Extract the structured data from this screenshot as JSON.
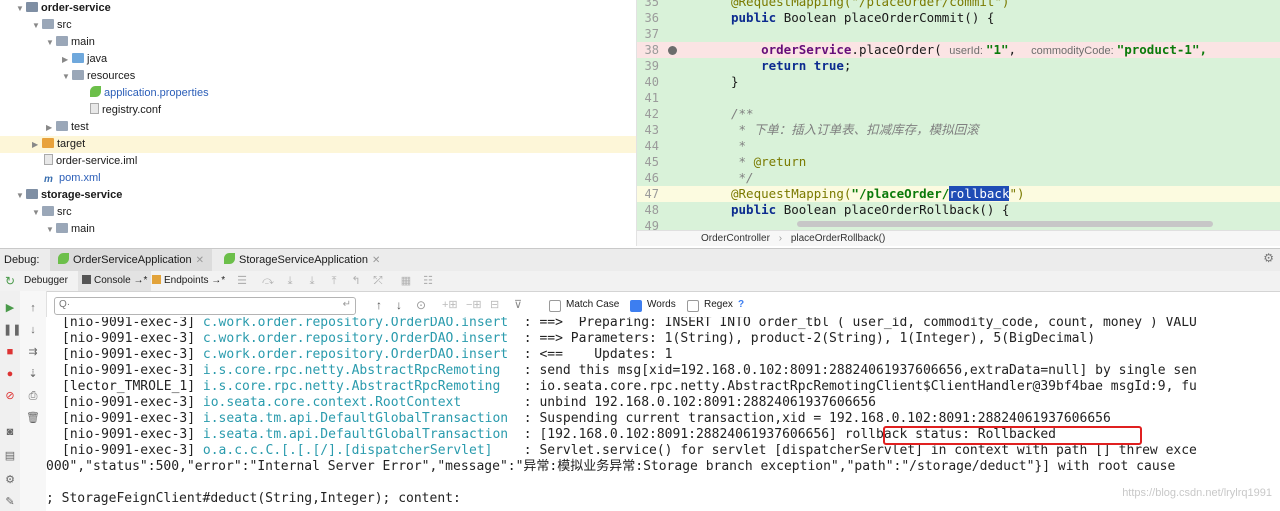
{
  "project_tree": {
    "items": [
      {
        "label": "order-service",
        "bold": true
      },
      {
        "label": "src"
      },
      {
        "label": "main"
      },
      {
        "label": "java"
      },
      {
        "label": "resources"
      },
      {
        "label": "application.properties"
      },
      {
        "label": "registry.conf"
      },
      {
        "label": "test"
      },
      {
        "label": "target"
      },
      {
        "label": "order-service.iml"
      },
      {
        "label": "pom.xml"
      },
      {
        "label": "storage-service",
        "bold": true
      },
      {
        "label": "src"
      },
      {
        "label": "main"
      }
    ]
  },
  "editor": {
    "lines": [
      {
        "n": "35",
        "segments": [
          {
            "t": "@RequestMapping(\"/placeOrder/commit\")",
            "c": "ann"
          }
        ]
      },
      {
        "n": "36",
        "segments": [
          {
            "t": "public ",
            "c": "kw"
          },
          {
            "t": "Boolean placeOrderCommit() {",
            "c": ""
          }
        ]
      },
      {
        "n": "37",
        "segments": []
      },
      {
        "n": "38",
        "segments": [
          {
            "t": "    ",
            "c": ""
          },
          {
            "t": "orderService",
            "c": "fld"
          },
          {
            "t": ".placeOrder( ",
            "c": ""
          },
          {
            "t": "userId: ",
            "c": "hint"
          },
          {
            "t": "\"1\"",
            "c": "str"
          },
          {
            "t": ",  ",
            "c": ""
          },
          {
            "t": "commodityCode: ",
            "c": "hint"
          },
          {
            "t": "\"product-1\",",
            "c": "str"
          }
        ]
      },
      {
        "n": "39",
        "segments": [
          {
            "t": "    ",
            "c": ""
          },
          {
            "t": "return true",
            "c": "kw"
          },
          {
            "t": ";",
            "c": ""
          }
        ]
      },
      {
        "n": "40",
        "segments": [
          {
            "t": "}",
            "c": ""
          }
        ]
      },
      {
        "n": "41",
        "segments": []
      },
      {
        "n": "42",
        "segments": [
          {
            "t": "/**",
            "c": "cmt"
          }
        ]
      },
      {
        "n": "43",
        "segments": [
          {
            "t": " * 下单：插入订单表、扣减库存，模拟回滚",
            "c": "cmt"
          }
        ]
      },
      {
        "n": "44",
        "segments": [
          {
            "t": " *",
            "c": "cmt"
          }
        ]
      },
      {
        "n": "45",
        "segments": [
          {
            "t": " * ",
            "c": "cmt"
          },
          {
            "t": "@return",
            "c": "ann"
          }
        ]
      },
      {
        "n": "46",
        "segments": [
          {
            "t": " */",
            "c": "cmt"
          }
        ]
      },
      {
        "n": "47",
        "segments": [
          {
            "t": "@RequestMapping(",
            "c": "ann"
          },
          {
            "t": "\"/placeOrder/",
            "c": "str"
          },
          {
            "t": "rollback",
            "c": "selbox"
          },
          {
            "t": "\")",
            "c": "ann"
          }
        ]
      },
      {
        "n": "48",
        "segments": [
          {
            "t": "public ",
            "c": "kw"
          },
          {
            "t": "Boolean placeOrderRollback() {",
            "c": ""
          }
        ]
      },
      {
        "n": "49",
        "segments": []
      }
    ],
    "breadcrumb": [
      "OrderController",
      "placeOrderRollback()"
    ],
    "breadcrumb_sep": "›"
  },
  "debug": {
    "label": "Debug:",
    "tabs": [
      "OrderServiceApplication",
      "StorageServiceApplication"
    ],
    "subtabs": {
      "debugger": "Debugger",
      "console": "Console",
      "endpoints": "Endpoints"
    },
    "search_placeholder": "Q·",
    "match_case": "Match Case",
    "words": "Words",
    "regex": "Regex",
    "regex_help": "?",
    "words_checked": true
  },
  "console": {
    "lines": [
      {
        "thread": "[nio-9091-exec-3]",
        "logger": "c.work.order.repository.OrderDAO.insert ",
        "msg": " : ==>  Preparing: INSERT INTO order_tbl ( user_id, commodity_code, count, money ) VALU"
      },
      {
        "thread": "[nio-9091-exec-3]",
        "logger": "c.work.order.repository.OrderDAO.insert ",
        "msg": " : ==> Parameters: 1(String), product-2(String), 1(Integer), 5(BigDecimal)"
      },
      {
        "thread": "[nio-9091-exec-3]",
        "logger": "c.work.order.repository.OrderDAO.insert ",
        "msg": " : <==    Updates: 1"
      },
      {
        "thread": "[nio-9091-exec-3]",
        "logger": "i.s.core.rpc.netty.AbstractRpcRemoting  ",
        "msg": " : send this msg[xid=192.168.0.102:8091:28824061937606656,extraData=null] by single sen"
      },
      {
        "thread": "[lector_TMROLE_1]",
        "logger": "i.s.core.rpc.netty.AbstractRpcRemoting  ",
        "msg": " : io.seata.core.rpc.netty.AbstractRpcRemotingClient$ClientHandler@39bf4bae msgId:9, fu"
      },
      {
        "thread": "[nio-9091-exec-3]",
        "logger": "io.seata.core.context.RootContext       ",
        "msg": " : unbind 192.168.0.102:8091:28824061937606656"
      },
      {
        "thread": "[nio-9091-exec-3]",
        "logger": "i.seata.tm.api.DefaultGlobalTransaction ",
        "msg": " : Suspending current transaction,xid = 192.168.0.102:8091:28824061937606656"
      },
      {
        "thread": "[nio-9091-exec-3]",
        "logger": "i.seata.tm.api.DefaultGlobalTransaction ",
        "msg": " : [192.168.0.102:8091:28824061937606656] rollback status: Rollbacked"
      },
      {
        "thread": "[nio-9091-exec-3]",
        "logger": "o.a.c.c.C.[.[.[/].[dispatcherServlet]   ",
        "msg": " : Servlet.service() for servlet [dispatcherServlet] in context with path [] threw exce"
      },
      {
        "thread": "",
        "logger": "",
        "msg": "000\",\"status\":500,\"error\":\"Internal Server Error\",\"message\":\"异常:模拟业务异常:Storage branch exception\",\"path\":\"/storage/deduct\"}] with root cause"
      },
      {
        "thread": "",
        "logger": "",
        "msg": ""
      },
      {
        "thread": "",
        "logger": "",
        "msg": "; StorageFeignClient#deduct(String,Integer); content:"
      }
    ]
  },
  "watermark": "https://blog.csdn.net/lrylrq1991"
}
